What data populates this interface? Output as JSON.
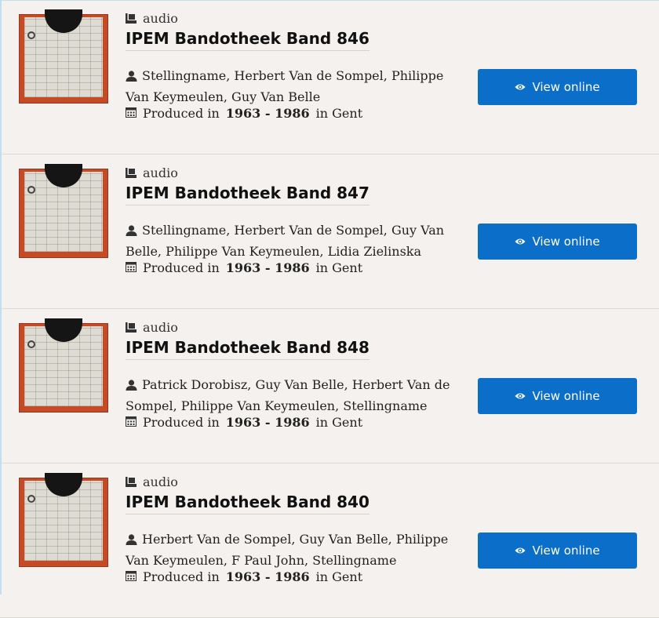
{
  "results": [
    {
      "type": "audio",
      "title": "IPEM Bandotheek Band 846",
      "authors": "Stellingname, Herbert Van de Sompel, Philippe Van Keymeulen, Guy Van Belle",
      "produced_prefix": "Produced in",
      "produced_range": "1963 - 1986",
      "produced_in": "in Gent",
      "button_label": "View online"
    },
    {
      "type": "audio",
      "title": "IPEM Bandotheek Band 847",
      "authors": "Stellingname, Herbert Van de Sompel, Guy Van Belle, Philippe Van Keymeulen, Lidia Zielinska",
      "produced_prefix": "Produced in",
      "produced_range": "1963 - 1986",
      "produced_in": "in Gent",
      "button_label": "View online"
    },
    {
      "type": "audio",
      "title": "IPEM Bandotheek Band 848",
      "authors": "Patrick Dorobisz, Guy Van Belle, Herbert Van de Sompel, Philippe Van Keymeulen, Stellingname",
      "produced_prefix": "Produced in",
      "produced_range": "1963 - 1986",
      "produced_in": "in Gent",
      "button_label": "View online"
    },
    {
      "type": "audio",
      "title": "IPEM Bandotheek Band 840",
      "authors": "Herbert Van de Sompel, Guy Van Belle, Philippe Van Keymeulen, F Paul John, Stellingname",
      "produced_prefix": "Produced in",
      "produced_range": "1963 - 1986",
      "produced_in": "in Gent",
      "button_label": "View online"
    }
  ],
  "colors": {
    "button": "#0b6fc9",
    "background": "#f4f1ee",
    "thumbnail_border": "#c84a25"
  },
  "icons": {
    "type": "book-icon",
    "authors": "person-icon",
    "produced": "calendar-icon",
    "button": "eye-icon"
  }
}
